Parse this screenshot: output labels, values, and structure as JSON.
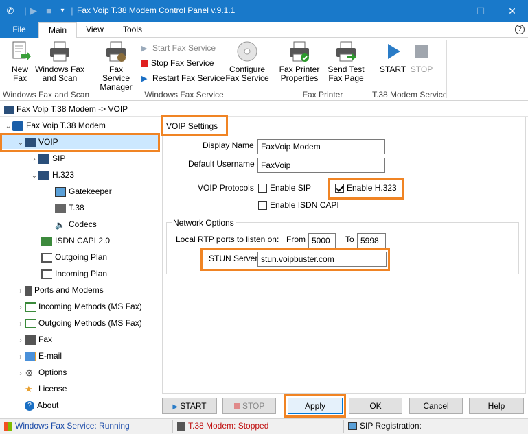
{
  "window": {
    "title": "Fax Voip T.38 Modem Control Panel v.9.1.1",
    "controls": {
      "minimize": "—",
      "maximize": "☐",
      "close": "✕"
    }
  },
  "ribbon_tabs": {
    "file": "File",
    "main": "Main",
    "view": "View",
    "tools": "Tools"
  },
  "ribbon": {
    "new_fax": "New\nFax",
    "windows_fax_scan": "Windows Fax\nand Scan",
    "group_windows_fax_scan": "Windows Fax and Scan",
    "fax_service_manager": "Fax Service\nManager",
    "start_fax_service": "Start Fax Service",
    "stop_fax_service": "Stop Fax Service",
    "restart_fax_service": "Restart Fax Service",
    "configure_fax_service": "Configure\nFax Service",
    "group_windows_fax_service": "Windows Fax Service",
    "fax_printer_properties": "Fax Printer\nProperties",
    "send_test_fax_page": "Send Test\nFax Page",
    "group_fax_printer": "Fax Printer",
    "start": "START",
    "stop": "STOP",
    "group_t38": "T.38 Modem Service"
  },
  "breadcrumb": "Fax Voip T.38 Modem -> VOIP",
  "tree": {
    "root": "Fax Voip T.38 Modem",
    "voip": "VOIP",
    "sip": "SIP",
    "h323": "H.323",
    "gatekeeper": "Gatekeeper",
    "t38": "T.38",
    "codecs": "Codecs",
    "isdn_capi": "ISDN CAPI 2.0",
    "outgoing_plan": "Outgoing Plan",
    "incoming_plan": "Incoming Plan",
    "ports_modems": "Ports and Modems",
    "incoming_methods": "Incoming Methods (MS Fax)",
    "outgoing_methods": "Outgoing Methods (MS Fax)",
    "fax": "Fax",
    "email": "E-mail",
    "options": "Options",
    "license": "License",
    "about": "About"
  },
  "settings": {
    "header": "VOIP Settings",
    "display_name_label": "Display Name",
    "display_name_value": "FaxVoip Modem",
    "default_username_label": "Default Username",
    "default_username_value": "FaxVoip",
    "voip_protocols_label": "VOIP Protocols",
    "enable_sip": "Enable SIP",
    "enable_sip_checked": false,
    "enable_h323": "Enable H.323",
    "enable_h323_checked": true,
    "enable_isdn": "Enable ISDN CAPI",
    "enable_isdn_checked": false,
    "network_options": "Network Options",
    "rtp_label": "Local RTP ports to listen on:",
    "from_label": "From",
    "from_value": "5000",
    "to_label": "To",
    "to_value": "5998",
    "stun_label": "STUN Server",
    "stun_value": "stun.voipbuster.com"
  },
  "buttons": {
    "start": "START",
    "stop": "STOP",
    "apply": "Apply",
    "ok": "OK",
    "cancel": "Cancel",
    "help": "Help"
  },
  "status": {
    "fax_service": "Windows Fax Service: Running",
    "t38_modem": "T.38 Modem: Stopped",
    "sip_registration": "SIP Registration:"
  },
  "colors": {
    "title_bar": "#1979ca",
    "highlight": "#f08424",
    "tree_selected": "#cce8ff",
    "status_running": "#1a4aa8",
    "status_stopped": "#c01010"
  }
}
